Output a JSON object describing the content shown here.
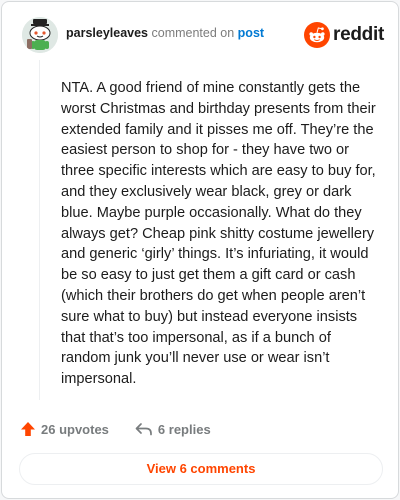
{
  "comment": {
    "username": "parsleyleaves",
    "action_text": "commented on",
    "target_link": "post",
    "body": "NTA. A good friend of mine constantly gets the worst Christmas and birthday presents from their extended family and it pisses me off. They’re the easiest person to shop for - they have two or three specific interests which are easy to buy for, and they exclusively wear black, grey or dark blue. Maybe purple occasionally. What do they always get? Cheap pink shitty costume jewellery and generic ‘girly’ things. It’s infuriating, it would be so easy to just get them a gift card or cash (which their brothers do get when people aren’t sure what to buy) but instead everyone insists that that’s too impersonal, as if a bunch of random junk you’ll never use or wear isn’t impersonal.",
    "upvotes_label": "26 upvotes",
    "replies_label": "6 replies"
  },
  "brand": {
    "wordmark": "reddit",
    "icon": "reddit-logo-icon",
    "color": "#ff4500"
  },
  "avatar": {
    "icon": "snoo-avatar-icon"
  },
  "icons": {
    "upvote": "upvote-arrow-icon",
    "reply": "reply-arrow-icon"
  },
  "footer": {
    "view_comments_label": "View 6 comments"
  },
  "colors": {
    "accent": "#ff4500",
    "link": "#0079d3",
    "muted": "#7c7c7c",
    "text": "#1c1c1c"
  }
}
